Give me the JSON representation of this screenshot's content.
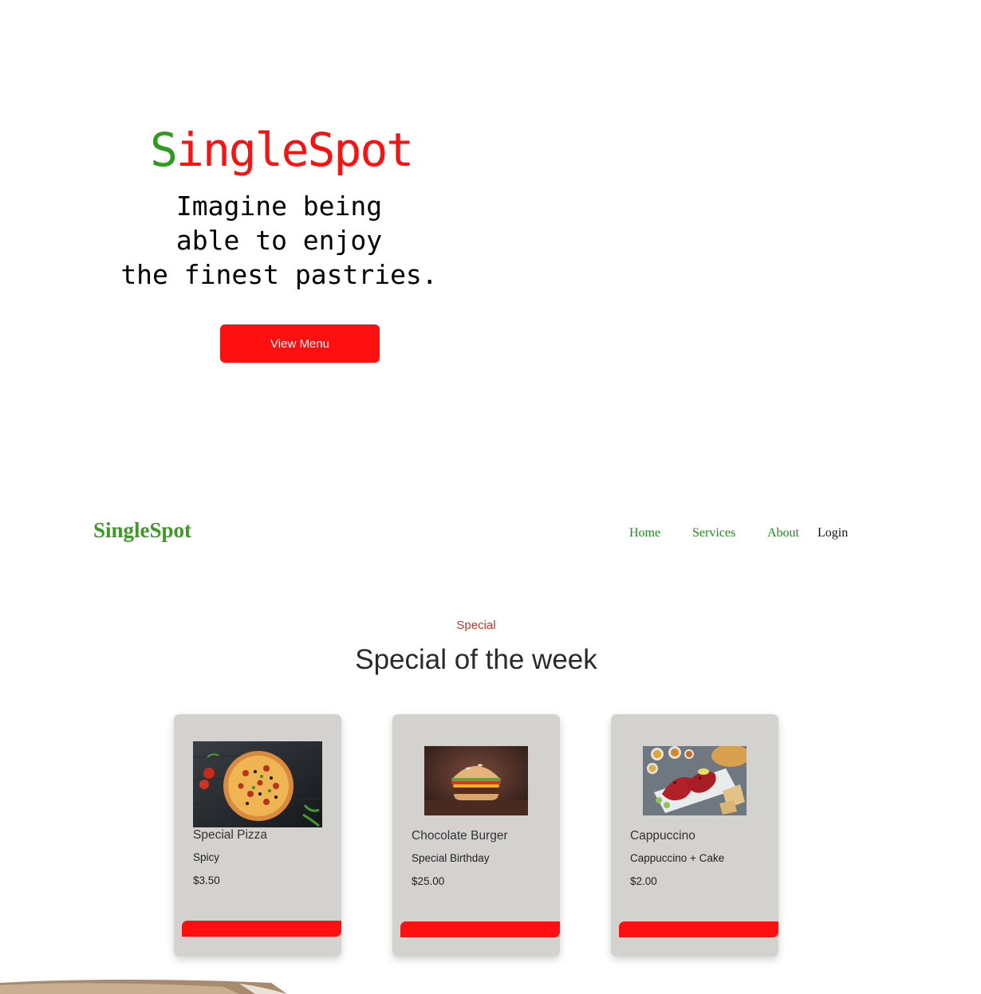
{
  "hero": {
    "logo_first": "S",
    "logo_rest": "ingleSpot",
    "tagline_lines": [
      "Imagine being",
      "able to enjoy",
      "the finest pastries."
    ],
    "cta_label": "View Menu"
  },
  "nav": {
    "brand": "SingleSpot",
    "links": [
      "Home",
      "Services",
      "About",
      "Login"
    ]
  },
  "special": {
    "kicker": "Special",
    "title": "Special of the week",
    "cards": [
      {
        "name": "Special Pizza",
        "description": "Spicy",
        "price": "$3.50",
        "image": "pizza-image"
      },
      {
        "name": "Chocolate Burger",
        "description": "Special Birthday",
        "price": "$25.00",
        "image": "burger-image"
      },
      {
        "name": "Cappuccino",
        "description": "Cappuccino + Cake",
        "price": "$2.00",
        "image": "grilled-chicken-image"
      }
    ]
  },
  "colors": {
    "brand_green": "#2e9a1e",
    "brand_red": "#ff1010",
    "card_bg": "#d3d2cf",
    "kicker_red": "#c0392b",
    "nav_green": "#1f8a1f"
  }
}
